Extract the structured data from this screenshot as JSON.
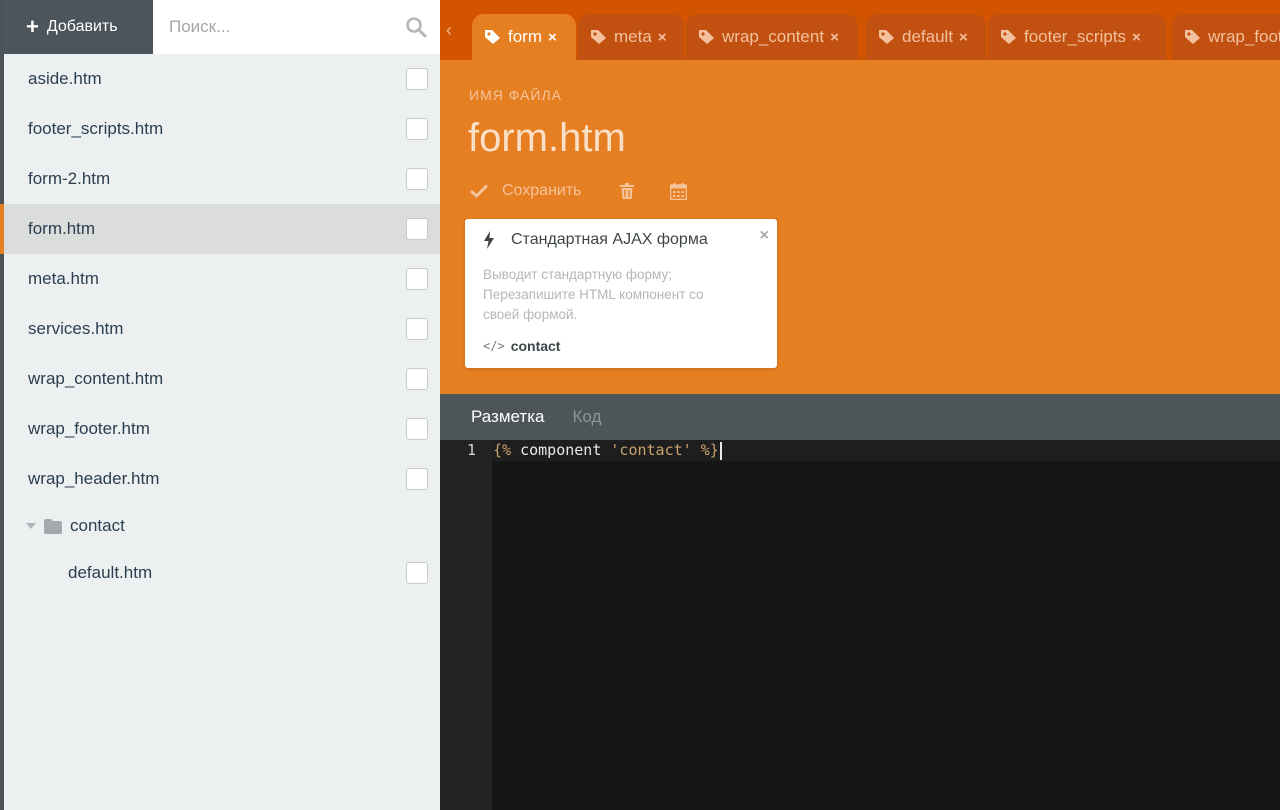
{
  "sidebar": {
    "add_label": "Добавить",
    "search_placeholder": "Поиск...",
    "files": [
      {
        "name": "aside.htm"
      },
      {
        "name": "footer_scripts.htm"
      },
      {
        "name": "form-2.htm"
      },
      {
        "name": "form.htm",
        "active": true
      },
      {
        "name": "meta.htm"
      },
      {
        "name": "services.htm"
      },
      {
        "name": "wrap_content.htm"
      },
      {
        "name": "wrap_footer.htm"
      },
      {
        "name": "wrap_header.htm"
      }
    ],
    "folder": {
      "name": "contact",
      "files": [
        {
          "name": "default.htm"
        }
      ]
    }
  },
  "tabs": [
    {
      "label": "form",
      "active": true
    },
    {
      "label": "meta"
    },
    {
      "label": "wrap_content"
    },
    {
      "label": "default"
    },
    {
      "label": "footer_scripts"
    },
    {
      "label": "wrap_footer"
    }
  ],
  "editor_header": {
    "field_label": "ИМЯ ФАЙЛА",
    "file_name": "form.htm",
    "save_label": "Сохранить"
  },
  "component": {
    "title": "Стандартная AJAX форма",
    "description": "Выводит стандартную форму; Перезапишите HTML компонент со своей формой.",
    "alias": "contact"
  },
  "editor_tabs": {
    "markup": "Разметка",
    "code": "Код"
  },
  "code": {
    "line_number": "1",
    "open_tag": "{%",
    "keyword": " component ",
    "string": "'contact'",
    "close_tag": " %}"
  },
  "colors": {
    "accent": "#e67e22",
    "tabbar": "#d35400",
    "sidebar_dark": "#4b555b"
  }
}
